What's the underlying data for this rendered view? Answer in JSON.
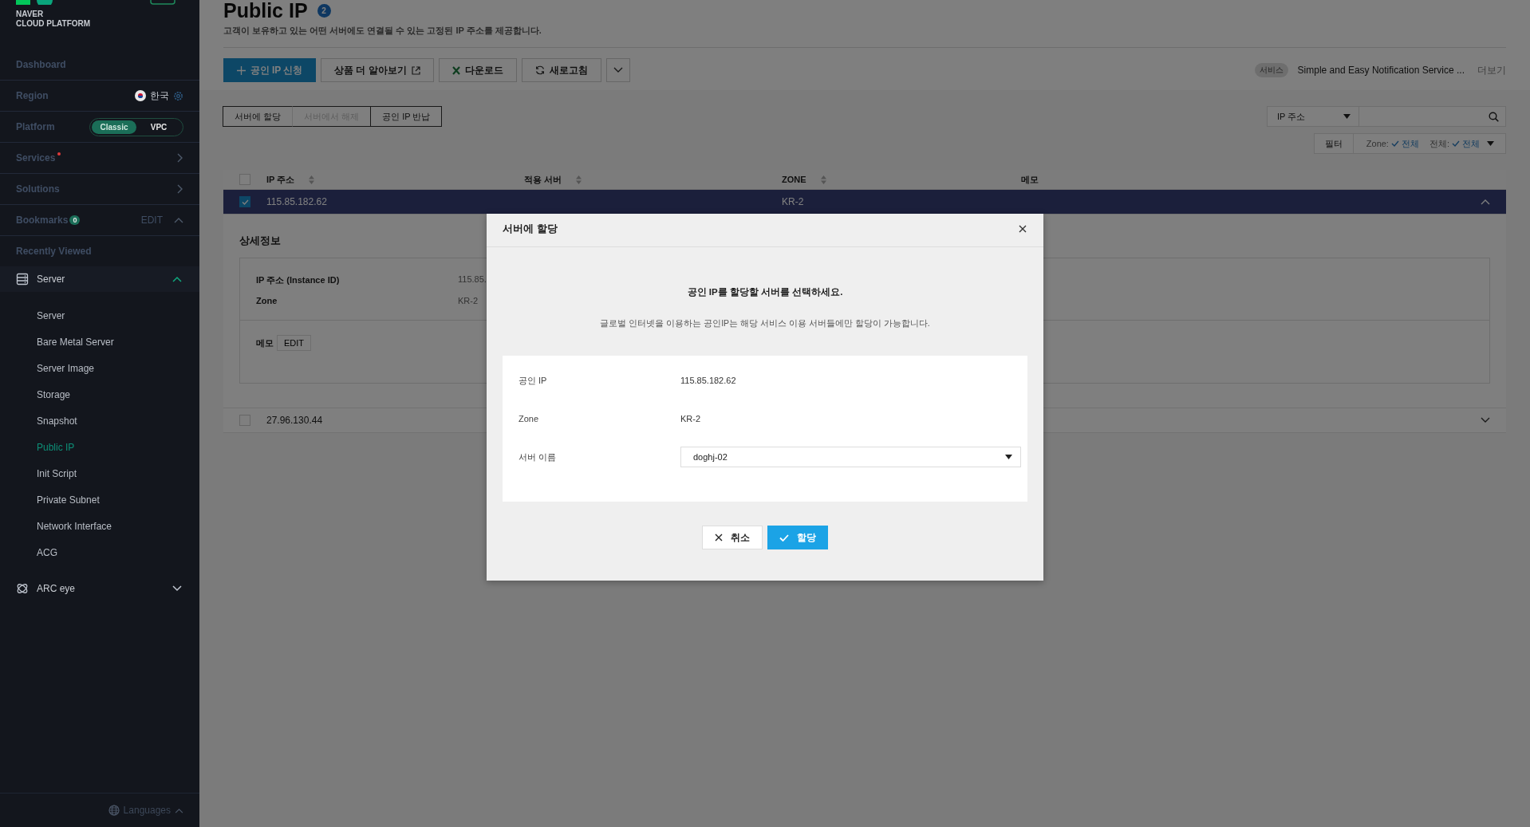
{
  "sidebar": {
    "brand": [
      "NAVER",
      "CLOUD PLATFORM"
    ],
    "menu": [
      {
        "kind": "link",
        "label": "Dashboard"
      },
      {
        "kind": "region",
        "label": "Region",
        "value": "한국"
      },
      {
        "kind": "platform",
        "label": "Platform",
        "options": [
          {
            "label": "Classic",
            "selected": true
          },
          {
            "label": "VPC",
            "selected": false
          }
        ]
      },
      {
        "kind": "nav",
        "label": "Services",
        "new": true
      },
      {
        "kind": "nav",
        "label": "Solutions",
        "new": false
      },
      {
        "kind": "bookmarks",
        "label": "Bookmarks",
        "count": "0",
        "action": "EDIT"
      },
      {
        "kind": "link",
        "label": "Recently Viewed"
      }
    ],
    "groups": [
      {
        "label": "Server",
        "expanded": true,
        "children": [
          {
            "label": "Server",
            "selected": false
          },
          {
            "label": "Bare Metal Server",
            "selected": false
          },
          {
            "label": "Server Image",
            "selected": false
          },
          {
            "label": "Storage",
            "selected": false
          },
          {
            "label": "Snapshot",
            "selected": false
          },
          {
            "label": "Public IP",
            "selected": true
          },
          {
            "label": "Init Script",
            "selected": false
          },
          {
            "label": "Private Subnet",
            "selected": false
          },
          {
            "label": "Network Interface",
            "selected": false
          },
          {
            "label": "ACG",
            "selected": false
          }
        ]
      },
      {
        "label": "ARC eye",
        "expanded": false
      }
    ],
    "footer": "Languages"
  },
  "page": {
    "title": "Public IP",
    "count": "2",
    "description": "고객이 보유하고 있는 어떤 서버에도 연결될 수 있는 고정된 IP 주소를 제공합니다.",
    "actions": [
      {
        "kind": "primary",
        "label": "공인 IP 신청"
      },
      {
        "kind": "external",
        "label": "상품 더 알아보기"
      },
      {
        "kind": "excel",
        "label": "다운로드"
      },
      {
        "kind": "refresh",
        "label": "새로고침"
      },
      {
        "kind": "more"
      }
    ],
    "notice": {
      "tag": "서비스",
      "text": "Simple and Easy Notification Service ...",
      "more": "더보기"
    }
  },
  "tabs": [
    {
      "label": "서버에 할당",
      "disabled": false
    },
    {
      "label": "서버에서 해제",
      "disabled": true
    },
    {
      "label": "공인 IP 반납",
      "disabled": false
    }
  ],
  "search": {
    "field": "IP 주소"
  },
  "filter": {
    "label": "필터",
    "items": [
      {
        "key": "Zone:",
        "value": "전체"
      },
      {
        "key": "전체:",
        "value": "전체"
      }
    ]
  },
  "table": {
    "select_all_checked": false,
    "columns": [
      {
        "label": "IP 주소",
        "sortable": true
      },
      {
        "label": "적용 서버",
        "sortable": true
      },
      {
        "label": "ZONE",
        "sortable": true
      },
      {
        "label": "메모",
        "sortable": false
      }
    ],
    "rows": [
      {
        "ip": "115.85.182.62",
        "zone": "KR-2",
        "checked": true,
        "expanded": true,
        "details": {
          "title": "상세정보",
          "fields": [
            {
              "label": "IP 주소 (Instance ID)",
              "value": "115.85."
            },
            {
              "label": "Zone",
              "value": "KR-2"
            }
          ],
          "memo_label": "메모",
          "memo_action": "EDIT"
        }
      },
      {
        "ip": "27.96.130.44",
        "checked": false,
        "expanded": false
      }
    ]
  },
  "modal": {
    "title": "서버에 할당",
    "heading": "공인 IP를 할당할 서버를 선택하세요.",
    "note": "글로벌 인터넷을 이용하는 공인IP는 해당 서비스 이용 서버들에만 할당이 가능합니다.",
    "fields": [
      {
        "kind": "text",
        "label": "공인 IP",
        "value": "115.85.182.62"
      },
      {
        "kind": "text",
        "label": "Zone",
        "value": "KR-2"
      },
      {
        "kind": "select",
        "label": "서버 이름",
        "value": "doghj-02"
      }
    ],
    "buttons": [
      {
        "kind": "cancel",
        "label": "취소"
      },
      {
        "kind": "confirm",
        "label": "할당"
      }
    ]
  }
}
